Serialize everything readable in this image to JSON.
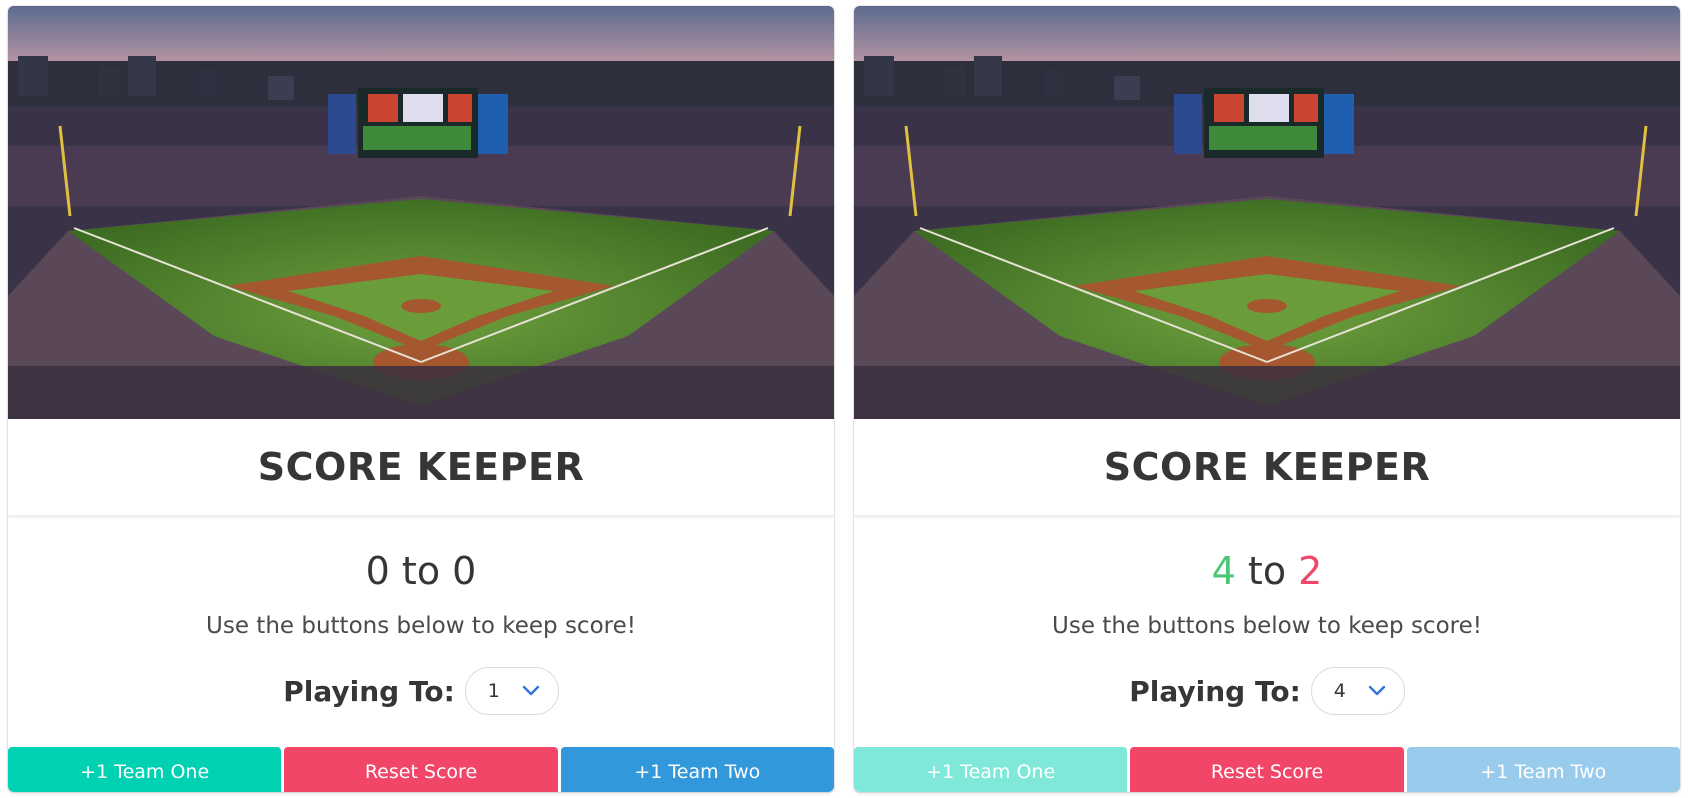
{
  "cards": [
    {
      "title": "SCORE KEEPER",
      "score": {
        "team_one": "0",
        "separator": "to",
        "team_two": "0"
      },
      "hint": "Use the buttons below to keep score!",
      "playing_to_label": "Playing To:",
      "playing_to_value": "1",
      "buttons": {
        "team_one": "+1 Team One",
        "reset": "Reset Score",
        "team_two": "+1 Team Two"
      },
      "disabled": false
    },
    {
      "title": "SCORE KEEPER",
      "score": {
        "team_one": "4",
        "separator": "to",
        "team_two": "2"
      },
      "hint": "Use the buttons below to keep score!",
      "playing_to_label": "Playing To:",
      "playing_to_value": "4",
      "buttons": {
        "team_one": "+1 Team One",
        "reset": "Reset Score",
        "team_two": "+1 Team Two"
      },
      "disabled": true
    }
  ],
  "colors": {
    "team_one_button": "#00d1b2",
    "team_one_button_disabled": "#7fe8d8",
    "reset_button": "#f14668",
    "team_two_button": "#3298dc",
    "team_two_button_disabled": "#99cbed",
    "winner_score": "#48c774",
    "loser_score": "#f14668"
  },
  "icons": {
    "select_arrow": "chevron-down-icon"
  }
}
